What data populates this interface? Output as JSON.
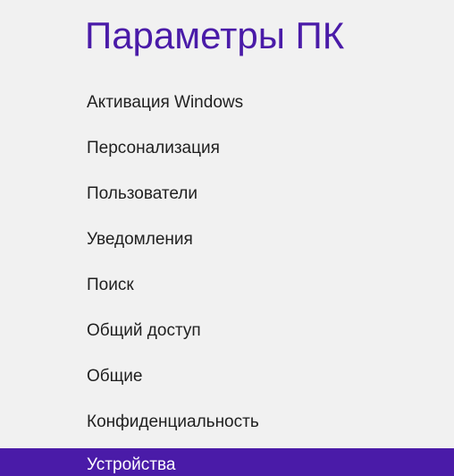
{
  "header": {
    "title": "Параметры ПК"
  },
  "nav": {
    "items": [
      {
        "label": "Активация Windows",
        "selected": false
      },
      {
        "label": "Персонализация",
        "selected": false
      },
      {
        "label": "Пользователи",
        "selected": false
      },
      {
        "label": "Уведомления",
        "selected": false
      },
      {
        "label": "Поиск",
        "selected": false
      },
      {
        "label": "Общий доступ",
        "selected": false
      },
      {
        "label": "Общие",
        "selected": false
      },
      {
        "label": "Конфиденциальность",
        "selected": false
      },
      {
        "label": "Устройства",
        "selected": true
      }
    ]
  },
  "colors": {
    "accent": "#4a1ba8",
    "background": "#f1f1f1",
    "text": "#1f1f1f",
    "selected_text": "#ffffff"
  }
}
